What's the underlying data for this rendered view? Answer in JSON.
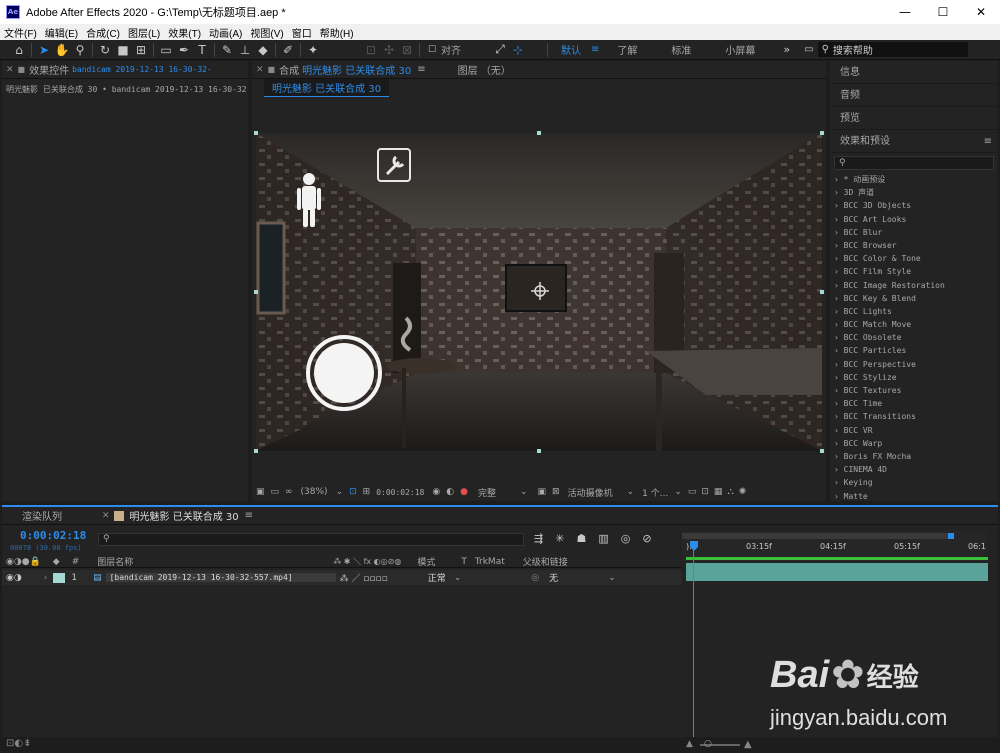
{
  "app": {
    "title": "Adobe After Effects 2020 - G:\\Temp\\无标题项目.aep *",
    "logo_text": "Ae",
    "minimize": "—",
    "maximize": "☐",
    "close": "✕"
  },
  "menu": [
    "文件(F)",
    "编辑(E)",
    "合成(C)",
    "图层(L)",
    "效果(T)",
    "动画(A)",
    "视图(V)",
    "窗口",
    "帮助(H)"
  ],
  "toolbar": {
    "align_label": "对齐",
    "workspaces": [
      "默认",
      "了解",
      "标准",
      "小屏幕"
    ],
    "active_workspace": "默认",
    "more": "»",
    "search_placeholder": "搜索帮助"
  },
  "effects_panel": {
    "tab_label": "效果控件",
    "tab_file": "bandicam 2019-12-13 16-30-32-",
    "breadcrumb": "明光魅影 已关联合成 30 • bandicam 2019-12-13 16-30-32-"
  },
  "comp_panel": {
    "tab_prefix": "合成",
    "tab_name": "明光魅影 已关联合成 30",
    "layer_tab": "图层 （无）",
    "sub_tab": "明光魅影 已关联合成 30",
    "zoom": "(38%)",
    "timecode": "0:00:02:18",
    "quality": "完整",
    "camera": "活动摄像机",
    "views": "1 个..."
  },
  "right_panel": {
    "sections": [
      "信息",
      "音频",
      "预览"
    ],
    "effects_title": "效果和预设",
    "effects_search_placeholder": "",
    "effects": [
      "* 动画预设",
      "3D 声道",
      "BCC 3D Objects",
      "BCC Art Looks",
      "BCC Blur",
      "BCC Browser",
      "BCC Color & Tone",
      "BCC Film Style",
      "BCC Image Restoration",
      "BCC Key & Blend",
      "BCC Lights",
      "BCC Match Move",
      "BCC Obsolete",
      "BCC Particles",
      "BCC Perspective",
      "BCC Stylize",
      "BCC Textures",
      "BCC Time",
      "BCC Transitions",
      "BCC VR",
      "BCC Warp",
      "Boris FX Mocha",
      "CINEMA 4D",
      "Keying",
      "Matte"
    ]
  },
  "timeline": {
    "render_queue_tab": "渲染队列",
    "comp_tab": "明光魅影 已关联合成 30",
    "timecode": "0:00:02:18",
    "frame_info": "00078 (30.00 fps)",
    "search_placeholder": "",
    "col_num": "#",
    "col_layer_name": "图层名称",
    "col_mode": "模式",
    "col_t": "T",
    "col_trkmat": "TrkMat",
    "col_parent": "父级和链接",
    "ruler": [
      "03:15f",
      "04:15f",
      "05:15f",
      "06:1"
    ],
    "ruler_start": "):",
    "layer": {
      "num": "1",
      "name": "[bandicam 2019-12-13 16-30-32-557.mp4]",
      "mode": "正常",
      "parent": "无"
    }
  },
  "watermark": {
    "brand": "Bai",
    "brand_cn": "经验",
    "url": "jingyan.baidu.com"
  },
  "colors": {
    "accent": "#2d8ceb",
    "track": "#5aa39b",
    "label": "#a5d9d3"
  }
}
